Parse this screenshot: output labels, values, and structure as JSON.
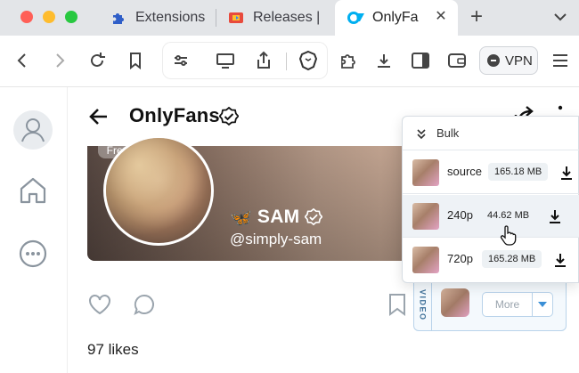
{
  "browser": {
    "tabs": [
      {
        "label": "Extensions",
        "icon": "puzzle-icon"
      },
      {
        "label": "Releases |",
        "icon": "releases-icon"
      },
      {
        "label": "OnlyFa",
        "icon": "onlyfans-logo-icon",
        "active": true
      }
    ],
    "new_tab": "+",
    "vpn_label": "VPN"
  },
  "sidebar": {
    "items": [
      {
        "name": "profile",
        "icon": "user-icon"
      },
      {
        "name": "home",
        "icon": "home-icon"
      },
      {
        "name": "more",
        "icon": "more-circle-icon"
      }
    ]
  },
  "header": {
    "title": "OnlyFans"
  },
  "profile": {
    "badge": "Free",
    "emoji": "🦋",
    "name": "SAM",
    "handle": "@simply-sam"
  },
  "post": {
    "likes": "97 likes"
  },
  "video_widget": {
    "label": "VIDEO",
    "more_label": "More"
  },
  "bulk_menu": {
    "header": "Bulk",
    "options": [
      {
        "label": "source",
        "size": "165.18 MB"
      },
      {
        "label": "240p",
        "size": "44.62 MB"
      },
      {
        "label": "720p",
        "size": "165.28 MB"
      }
    ]
  },
  "colors": {
    "accent": "#00aff0",
    "widget_border": "#b9d3ea",
    "widget_text": "#3a6d96"
  }
}
